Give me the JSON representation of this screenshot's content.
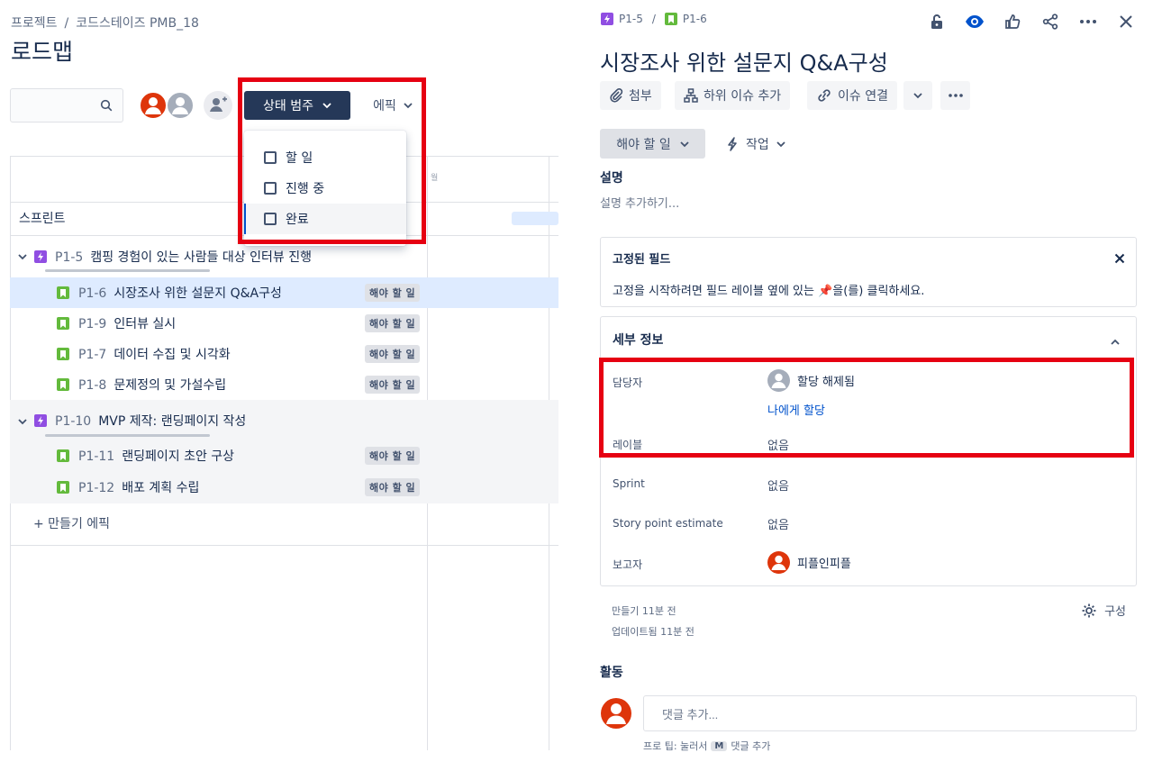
{
  "breadcrumb": {
    "project": "프로젝트",
    "separator": "/",
    "space": "코드스테이즈 PMB_18"
  },
  "page": {
    "title": "로드맵"
  },
  "toolbar": {
    "search_placeholder": "",
    "status_filter_label": "상태 범주",
    "epic_filter_label": "에픽"
  },
  "status_dropdown": {
    "items": [
      {
        "label": "할 일"
      },
      {
        "label": "진행 중"
      },
      {
        "label": "완료"
      }
    ]
  },
  "timeline": {
    "sprint_label": "스프린트",
    "column_hint": "월"
  },
  "tree": {
    "epics": [
      {
        "key": "P1-5",
        "summary": "캠핑 경험이 있는 사람들 대상 인터뷰 진행",
        "children": [
          {
            "key": "P1-6",
            "summary": "시장조사 위한 설문지 Q&A구성",
            "status": "해야 할 일"
          },
          {
            "key": "P1-9",
            "summary": "인터뷰 실시",
            "status": "해야 할 일"
          },
          {
            "key": "P1-7",
            "summary": "데이터 수집 및 시각화",
            "status": "해야 할 일"
          },
          {
            "key": "P1-8",
            "summary": "문제정의 및 가설수립",
            "status": "해야 할 일"
          }
        ]
      },
      {
        "key": "P1-10",
        "summary": "MVP 제작: 랜딩페이지 작성",
        "children": [
          {
            "key": "P1-11",
            "summary": "랜딩페이지 초안 구상",
            "status": "해야 할 일"
          },
          {
            "key": "P1-12",
            "summary": "배포 계획 수립",
            "status": "해야 할 일"
          }
        ]
      }
    ],
    "create_epic_label": "+ 만들기 에픽"
  },
  "issue": {
    "parent_key": "P1-5",
    "separator": "/",
    "key": "P1-6",
    "title": "시장조사 위한 설문지 Q&A구성",
    "actions": {
      "attach": "첨부",
      "add_child": "하위 이슈 추가",
      "link_issue": "이슈 연결"
    },
    "status": "해야 할 일",
    "workflow_action": "작업",
    "description": {
      "heading": "설명",
      "placeholder": "설명 추가하기..."
    },
    "pinned": {
      "heading": "고정된 필드",
      "message": "고정을 시작하려면 필드 레이블 옆에 있는 📌을(를) 클릭하세요."
    },
    "details": {
      "heading": "세부 정보",
      "assignee_label": "담당자",
      "assignee_value": "할당 해제됨",
      "assign_to_me": "나에게 할당",
      "labels_label": "레이블",
      "labels_value": "없음",
      "sprint_label": "Sprint",
      "sprint_value": "없음",
      "story_points_label": "Story point estimate",
      "story_points_value": "없음",
      "reporter_label": "보고자",
      "reporter_value": "피플인피플"
    },
    "meta": {
      "created": "만들기 11분 전",
      "updated": "업데이트됨 11분 전",
      "configure": "구성"
    },
    "activity": {
      "heading": "활동",
      "comment_placeholder": "댓글 추가...",
      "tip_prefix": "프로 팁: 눌러서",
      "tip_key": "M",
      "tip_suffix": "댓글 추가"
    }
  },
  "colors": {
    "accent": "#0052cc",
    "highlight": "#e60012",
    "epic": "#904ee2",
    "story": "#63ba3c",
    "dark_button": "#253858"
  }
}
